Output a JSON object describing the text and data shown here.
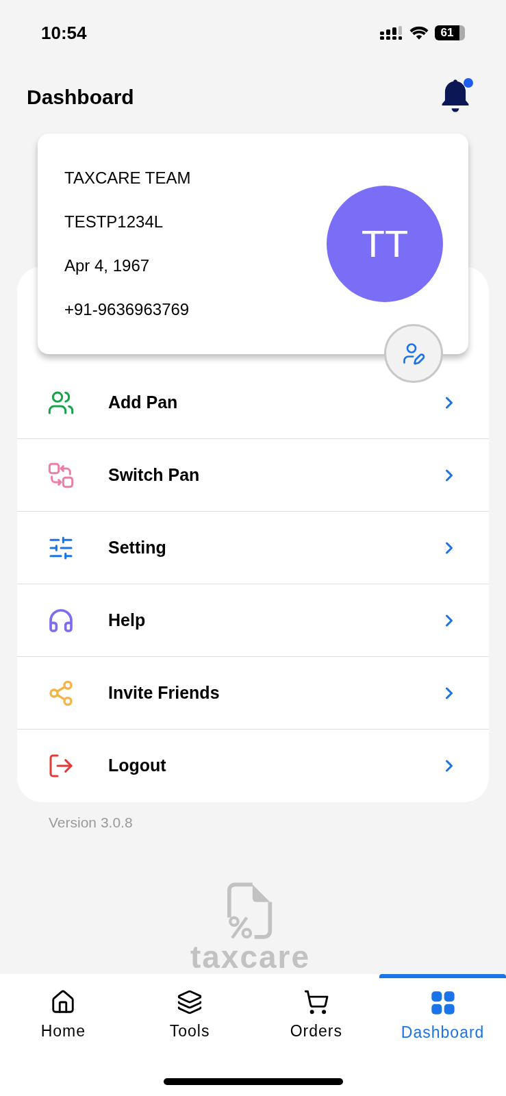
{
  "status_bar": {
    "time": "10:54",
    "battery": "61"
  },
  "header": {
    "title": "Dashboard",
    "notification_dot": true
  },
  "profile": {
    "name": "TAXCARE TEAM",
    "pan": "TESTP1234L",
    "dob": "Apr 4, 1967",
    "phone": "+91-9636963769",
    "initials": "TT"
  },
  "menu": [
    {
      "kind": "users",
      "label": "Add Pan",
      "color": "#16a34a"
    },
    {
      "kind": "switch",
      "label": "Switch Pan",
      "color": "#ec7fa4"
    },
    {
      "kind": "sliders",
      "label": "Setting",
      "color": "#1a73e8"
    },
    {
      "kind": "headset",
      "label": "Help",
      "color": "#7c6cf0"
    },
    {
      "kind": "share",
      "label": "Invite Friends",
      "color": "#f5b342"
    },
    {
      "kind": "logout",
      "label": "Logout",
      "color": "#e53935"
    }
  ],
  "version": "Version 3.0.8",
  "logo": {
    "text": "taxcare"
  },
  "tabs": [
    {
      "kind": "home",
      "label": "Home",
      "selected": false
    },
    {
      "kind": "tools",
      "label": "Tools",
      "selected": false
    },
    {
      "kind": "orders",
      "label": "Orders",
      "selected": false
    },
    {
      "kind": "dashboard",
      "label": "Dashboard",
      "selected": true
    }
  ]
}
